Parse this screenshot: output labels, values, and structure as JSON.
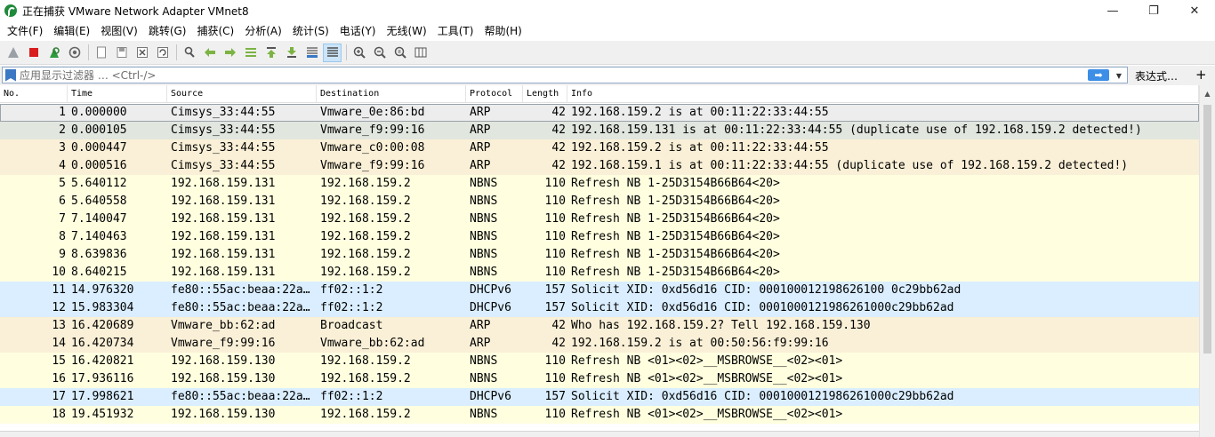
{
  "window": {
    "title": "正在捕获 VMware Network Adapter VMnet8",
    "minimize_glyph": "—",
    "maximize_glyph": "❐",
    "close_glyph": "✕"
  },
  "menu": [
    "文件(F)",
    "编辑(E)",
    "视图(V)",
    "跳转(G)",
    "捕获(C)",
    "分析(A)",
    "统计(S)",
    "电话(Y)",
    "无线(W)",
    "工具(T)",
    "帮助(H)"
  ],
  "toolbar": {
    "icons": [
      "shark-fin-start-icon",
      "stop-capture-icon",
      "restart-capture-icon",
      "capture-options-icon",
      "open-file-icon",
      "save-file-icon",
      "close-file-icon",
      "reload-file-icon",
      "find-packet-icon",
      "go-back-icon",
      "go-forward-icon",
      "go-to-packet-icon",
      "go-first-icon",
      "go-last-icon",
      "autoscroll-icon",
      "colorize-icon",
      "zoom-in-icon",
      "zoom-out-icon",
      "zoom-normal-icon",
      "resize-columns-icon"
    ]
  },
  "filter": {
    "placeholder": "应用显示过滤器 … <Ctrl-/>",
    "apply_glyph": "➡",
    "dropdown_glyph": "▼",
    "expression_label": "表达式…",
    "add_label": "+"
  },
  "columns": [
    "No.",
    "Time",
    "Source",
    "Destination",
    "Protocol",
    "Length",
    "Info"
  ],
  "colors": {
    "arp": "#faf0d7",
    "arp_alt": "#e7e6da",
    "nbns": "#ffffe0",
    "dhcpv6": "#daeeff",
    "selected_outline": "#9aa3aa"
  },
  "packets": [
    {
      "no": "1",
      "time": "0.000000",
      "src": "Cimsys_33:44:55",
      "dst": "Vmware_0e:86:bd",
      "proto": "ARP",
      "len": "42",
      "info": "192.168.159.2 is at 00:11:22:33:44:55",
      "color": "#ededed",
      "selected": true
    },
    {
      "no": "2",
      "time": "0.000105",
      "src": "Cimsys_33:44:55",
      "dst": "Vmware_f9:99:16",
      "proto": "ARP",
      "len": "42",
      "info": "192.168.159.131 is at 00:11:22:33:44:55 (duplicate use of 192.168.159.2 detected!)",
      "color": "#e1e6df"
    },
    {
      "no": "3",
      "time": "0.000447",
      "src": "Cimsys_33:44:55",
      "dst": "Vmware_c0:00:08",
      "proto": "ARP",
      "len": "42",
      "info": "192.168.159.2 is at 00:11:22:33:44:55",
      "color": "#faf0d7"
    },
    {
      "no": "4",
      "time": "0.000516",
      "src": "Cimsys_33:44:55",
      "dst": "Vmware_f9:99:16",
      "proto": "ARP",
      "len": "42",
      "info": "192.168.159.1 is at 00:11:22:33:44:55 (duplicate use of 192.168.159.2 detected!)",
      "color": "#faf0d7"
    },
    {
      "no": "5",
      "time": "5.640112",
      "src": "192.168.159.131",
      "dst": "192.168.159.2",
      "proto": "NBNS",
      "len": "110",
      "info": "Refresh NB 1-25D3154B66B64<20>",
      "color": "#ffffe0"
    },
    {
      "no": "6",
      "time": "5.640558",
      "src": "192.168.159.131",
      "dst": "192.168.159.2",
      "proto": "NBNS",
      "len": "110",
      "info": "Refresh NB 1-25D3154B66B64<20>",
      "color": "#ffffe0"
    },
    {
      "no": "7",
      "time": "7.140047",
      "src": "192.168.159.131",
      "dst": "192.168.159.2",
      "proto": "NBNS",
      "len": "110",
      "info": "Refresh NB 1-25D3154B66B64<20>",
      "color": "#ffffe0"
    },
    {
      "no": "8",
      "time": "7.140463",
      "src": "192.168.159.131",
      "dst": "192.168.159.2",
      "proto": "NBNS",
      "len": "110",
      "info": "Refresh NB 1-25D3154B66B64<20>",
      "color": "#ffffe0"
    },
    {
      "no": "9",
      "time": "8.639836",
      "src": "192.168.159.131",
      "dst": "192.168.159.2",
      "proto": "NBNS",
      "len": "110",
      "info": "Refresh NB 1-25D3154B66B64<20>",
      "color": "#ffffe0"
    },
    {
      "no": "10",
      "time": "8.640215",
      "src": "192.168.159.131",
      "dst": "192.168.159.2",
      "proto": "NBNS",
      "len": "110",
      "info": "Refresh NB 1-25D3154B66B64<20>",
      "color": "#ffffe0"
    },
    {
      "no": "11",
      "time": "14.976320",
      "src": "fe80::55ac:beaa:22a…",
      "dst": "ff02::1:2",
      "proto": "DHCPv6",
      "len": "157",
      "info": "Solicit XID: 0xd56d16 CID: 000100012198626100 0c29bb62ad",
      "color": "#daeeff"
    },
    {
      "no": "12",
      "time": "15.983304",
      "src": "fe80::55ac:beaa:22a…",
      "dst": "ff02::1:2",
      "proto": "DHCPv6",
      "len": "157",
      "info": "Solicit XID: 0xd56d16 CID: 0001000121986261000c29bb62ad",
      "color": "#daeeff"
    },
    {
      "no": "13",
      "time": "16.420689",
      "src": "Vmware_bb:62:ad",
      "dst": "Broadcast",
      "proto": "ARP",
      "len": "42",
      "info": "Who has 192.168.159.2? Tell 192.168.159.130",
      "color": "#faf0d7"
    },
    {
      "no": "14",
      "time": "16.420734",
      "src": "Vmware_f9:99:16",
      "dst": "Vmware_bb:62:ad",
      "proto": "ARP",
      "len": "42",
      "info": "192.168.159.2 is at 00:50:56:f9:99:16",
      "color": "#faf0d7"
    },
    {
      "no": "15",
      "time": "16.420821",
      "src": "192.168.159.130",
      "dst": "192.168.159.2",
      "proto": "NBNS",
      "len": "110",
      "info": "Refresh NB <01><02>__MSBROWSE__<02><01>",
      "color": "#ffffe0"
    },
    {
      "no": "16",
      "time": "17.936116",
      "src": "192.168.159.130",
      "dst": "192.168.159.2",
      "proto": "NBNS",
      "len": "110",
      "info": "Refresh NB <01><02>__MSBROWSE__<02><01>",
      "color": "#ffffe0"
    },
    {
      "no": "17",
      "time": "17.998621",
      "src": "fe80::55ac:beaa:22a…",
      "dst": "ff02::1:2",
      "proto": "DHCPv6",
      "len": "157",
      "info": "Solicit XID: 0xd56d16 CID: 0001000121986261000c29bb62ad",
      "color": "#daeeff"
    },
    {
      "no": "18",
      "time": "19.451932",
      "src": "192.168.159.130",
      "dst": "192.168.159.2",
      "proto": "NBNS",
      "len": "110",
      "info": "Refresh NB <01><02>__MSBROWSE__<02><01>",
      "color": "#ffffe0"
    }
  ]
}
